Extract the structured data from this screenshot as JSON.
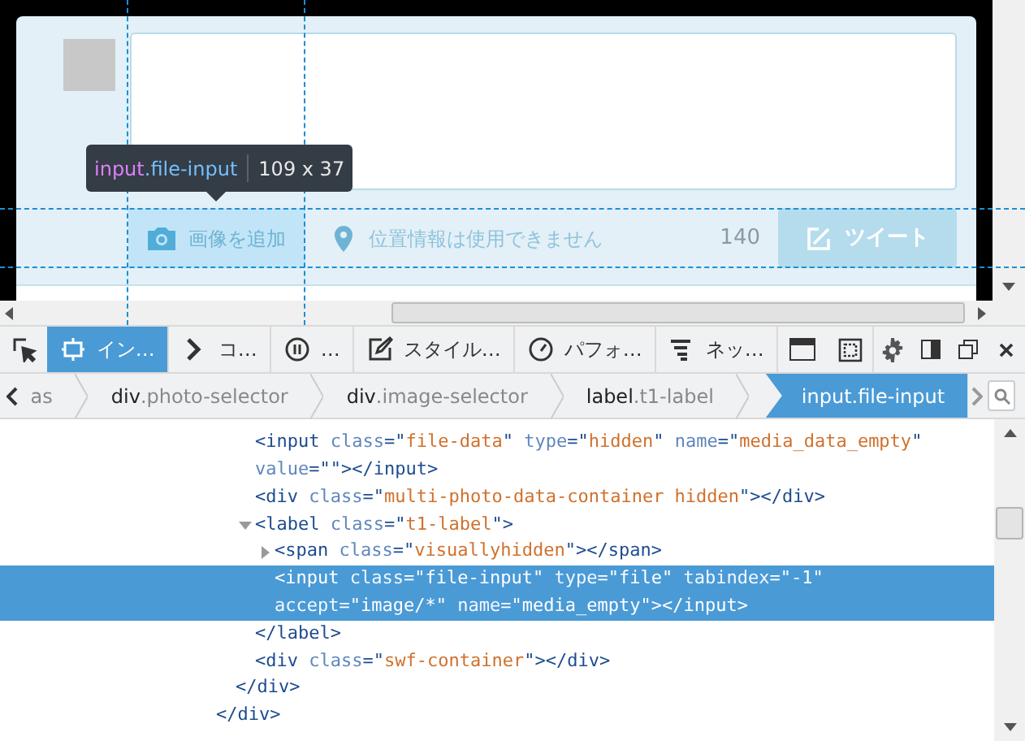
{
  "page": {
    "photo_button": {
      "label": "画像を追加",
      "highlighted": true
    },
    "location": {
      "label": "位置情報は使用できません"
    },
    "counter": "140",
    "tweet_button": {
      "label": "ツイート",
      "disabled": true
    }
  },
  "highlighter": {
    "tag": "input",
    "cls": ".file-input",
    "size": "109 x 37"
  },
  "toolbar": {
    "tabs": [
      {
        "label": "イン…",
        "kind": "inspector",
        "selected": true
      },
      {
        "label": "コ…",
        "kind": "console",
        "selected": false
      },
      {
        "label": "…",
        "kind": "debugger",
        "selected": false
      },
      {
        "label": "スタイル…",
        "kind": "style",
        "selected": false
      },
      {
        "label": "パフォ…",
        "kind": "performance",
        "selected": false
      },
      {
        "label": "ネッ…",
        "kind": "network",
        "selected": false
      }
    ]
  },
  "breadcrumbs": [
    {
      "cls": "as",
      "selected": false
    },
    {
      "tag": "div",
      "cls": ".photo-selector",
      "selected": false
    },
    {
      "tag": "div",
      "cls": ".image-selector",
      "selected": false
    },
    {
      "tag": "label",
      "cls": ".t1-label",
      "selected": false
    },
    {
      "tag": "input",
      "cls": ".file-input",
      "selected": true
    }
  ],
  "markup": [
    {
      "close": "</div>",
      "children": [
        {
          "close": "</div>",
          "children": [
            {
              "lines": [
                [
                  {
                    "kind": "tag",
                    "text": "<input "
                  },
                  {
                    "kind": "attr",
                    "text": "class"
                  },
                  {
                    "kind": "tag",
                    "text": "=\""
                  },
                  {
                    "kind": "value",
                    "text": "file-data"
                  },
                  {
                    "kind": "tag",
                    "text": "\" "
                  },
                  {
                    "kind": "attr",
                    "text": "type"
                  },
                  {
                    "kind": "tag",
                    "text": "=\""
                  },
                  {
                    "kind": "value",
                    "text": "hidden"
                  },
                  {
                    "kind": "tag",
                    "text": "\" "
                  },
                  {
                    "kind": "attr",
                    "text": "name"
                  },
                  {
                    "kind": "tag",
                    "text": "=\""
                  },
                  {
                    "kind": "value",
                    "text": "media_data_empty"
                  },
                  {
                    "kind": "tag",
                    "text": "\""
                  }
                ],
                [
                  {
                    "kind": "attr",
                    "text": "value"
                  },
                  {
                    "kind": "tag",
                    "text": "=\"\"></input>"
                  }
                ]
              ],
              "selected": false
            },
            {
              "lines": [
                [
                  {
                    "kind": "tag",
                    "text": "<div "
                  },
                  {
                    "kind": "attr",
                    "text": "class"
                  },
                  {
                    "kind": "tag",
                    "text": "=\""
                  },
                  {
                    "kind": "value",
                    "text": "multi-photo-data-container hidden"
                  },
                  {
                    "kind": "tag",
                    "text": "\"></div>"
                  }
                ]
              ],
              "selected": false
            },
            {
              "lines": [
                [
                  {
                    "kind": "tag",
                    "text": "<label "
                  },
                  {
                    "kind": "attr",
                    "text": "class"
                  },
                  {
                    "kind": "tag",
                    "text": "=\""
                  },
                  {
                    "kind": "value",
                    "text": "t1-label"
                  },
                  {
                    "kind": "tag",
                    "text": "\">"
                  }
                ]
              ],
              "selected": false,
              "expanded": true,
              "close": "</label>",
              "children": [
                {
                  "lines": [
                    [
                      {
                        "kind": "tag",
                        "text": "<span "
                      },
                      {
                        "kind": "attr",
                        "text": "class"
                      },
                      {
                        "kind": "tag",
                        "text": "=\""
                      },
                      {
                        "kind": "value",
                        "text": "visuallyhidden"
                      },
                      {
                        "kind": "tag",
                        "text": "\"></span>"
                      }
                    ]
                  ],
                  "selected": false,
                  "expanded": false
                },
                {
                  "lines": [
                    [
                      {
                        "kind": "tag",
                        "text": "<input "
                      },
                      {
                        "kind": "attr",
                        "text": "class"
                      },
                      {
                        "kind": "tag",
                        "text": "=\""
                      },
                      {
                        "kind": "value",
                        "text": "file-input"
                      },
                      {
                        "kind": "tag",
                        "text": "\" "
                      },
                      {
                        "kind": "attr",
                        "text": "type"
                      },
                      {
                        "kind": "tag",
                        "text": "=\""
                      },
                      {
                        "kind": "value",
                        "text": "file"
                      },
                      {
                        "kind": "tag",
                        "text": "\" "
                      },
                      {
                        "kind": "attr",
                        "text": "tabindex"
                      },
                      {
                        "kind": "tag",
                        "text": "=\""
                      },
                      {
                        "kind": "value",
                        "text": "-1"
                      },
                      {
                        "kind": "tag",
                        "text": "\""
                      }
                    ],
                    [
                      {
                        "kind": "attr",
                        "text": "accept"
                      },
                      {
                        "kind": "tag",
                        "text": "=\""
                      },
                      {
                        "kind": "value",
                        "text": "image/*"
                      },
                      {
                        "kind": "tag",
                        "text": "\" "
                      },
                      {
                        "kind": "attr",
                        "text": "name"
                      },
                      {
                        "kind": "tag",
                        "text": "=\""
                      },
                      {
                        "kind": "value",
                        "text": "media_empty"
                      },
                      {
                        "kind": "tag",
                        "text": "\"></input>"
                      }
                    ]
                  ],
                  "selected": true
                }
              ]
            },
            {
              "lines": [
                [
                  {
                    "kind": "tag",
                    "text": "<div "
                  },
                  {
                    "kind": "attr",
                    "text": "class"
                  },
                  {
                    "kind": "tag",
                    "text": "=\""
                  },
                  {
                    "kind": "value",
                    "text": "swf-container"
                  },
                  {
                    "kind": "tag",
                    "text": "\"></div>"
                  }
                ]
              ],
              "selected": false
            }
          ]
        }
      ]
    }
  ]
}
